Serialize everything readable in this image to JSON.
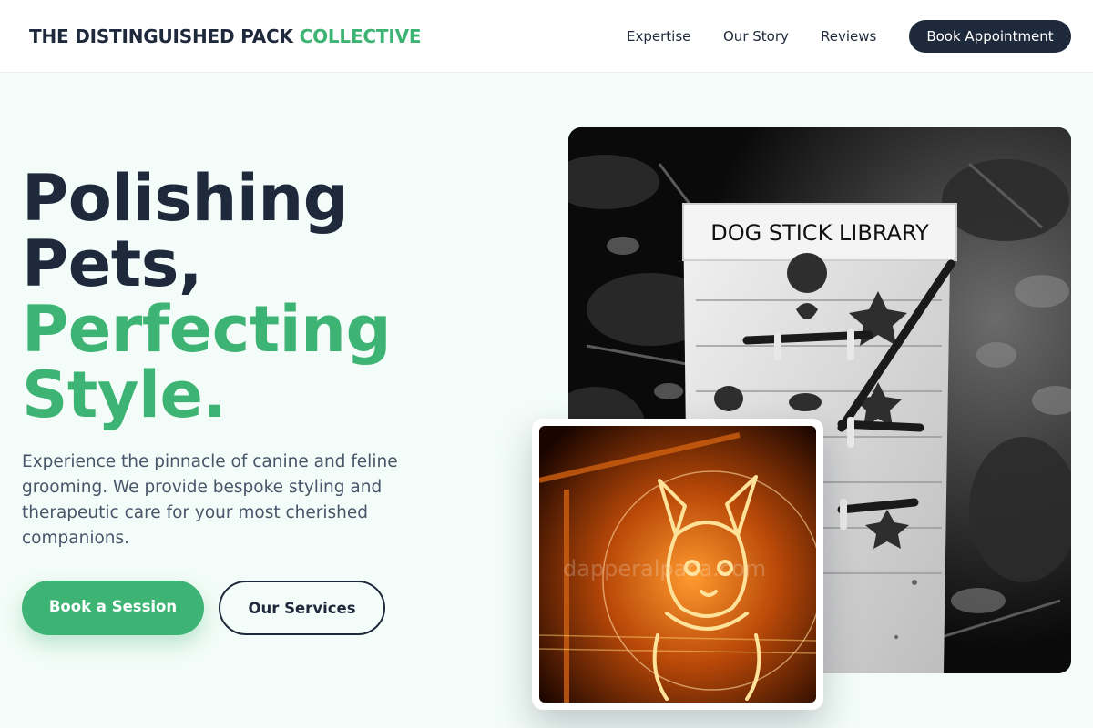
{
  "header": {
    "brand_main": "THE DISTINGUISHED PACK",
    "brand_accent": "COLLECTIVE",
    "nav": {
      "expertise": "Expertise",
      "story": "Our Story",
      "reviews": "Reviews"
    },
    "cta": "Book Appointment"
  },
  "hero": {
    "headline": {
      "line1": "Polishing",
      "line2": "Pets,",
      "line3": "Perfecting",
      "line4": "Style."
    },
    "lead": "Experience the pinnacle of canine and feline grooming. We provide bespoke styling and therapeutic care for your most cherished companions.",
    "primary_button": "Book a Session",
    "secondary_button": "Our Services"
  },
  "images": {
    "main_photo_sign": "DOG STICK LIBRARY",
    "overlay_watermark": "dapperalpaca.com"
  },
  "colors": {
    "accent": "#3db374",
    "dark": "#1e293b",
    "background": "#f3fcf8"
  }
}
